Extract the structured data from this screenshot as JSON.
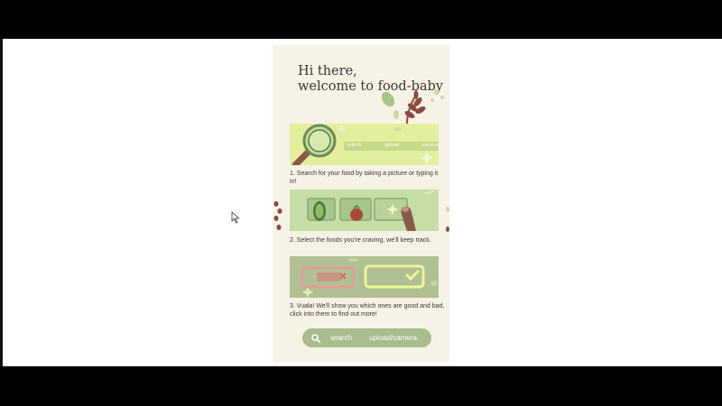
{
  "greeting": {
    "line1": "Hi there,",
    "line2": "welcome to food-baby"
  },
  "steps": [
    {
      "text": "1. Search for your food by taking a picture or typing it in!",
      "banner_labels": [
        "search",
        "upload",
        "camera"
      ]
    },
    {
      "text": "2. Select the foods you're craving, we'll keep track."
    },
    {
      "text": "3. Vuala! We'll show you which ones are good and bad, click into them to find out more!"
    }
  ],
  "bottom_bar": {
    "search_label": "search",
    "upload_label": "upload/camera",
    "icon": "search-icon"
  },
  "colors": {
    "page_bg": "#f7f2e6",
    "card1": "#e4ef9e",
    "card2": "#c6dea6",
    "card3": "#b1c092",
    "bar": "#a8bc8c",
    "text": "#3d3434"
  }
}
